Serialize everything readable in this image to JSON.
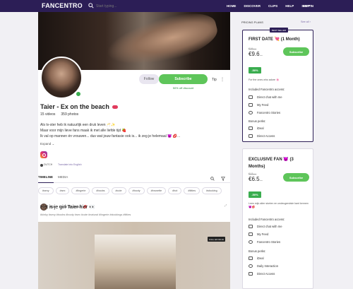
{
  "topnav": {
    "logo": "FANCENTRO",
    "search_placeholder": "Start typing...",
    "links": [
      "HOME",
      "DISCOVER",
      "CLIPS",
      "HELP",
      "SIGN IN"
    ],
    "language": "EN"
  },
  "profile": {
    "follow_label": "Follow",
    "subscribe_label": "Subscribe",
    "discount_label": "50% off discount",
    "tip_label": "Tip",
    "name": "Taier - Ex on the beach",
    "videos": "15 videos",
    "photos": "359 photos",
    "bio_lines": [
      "Als tv-ster heb ik natuurlijk een druk leven 🥂✨",
      "Maar voor mijn lieve fans maak ik met alle liefde tijd 🍓",
      "Ik val op mannen én vrouwen... dus wat jouw fantasie ook is... ik zeg je helemaal 😈 💋..."
    ],
    "expand_label": "Expand",
    "language_tag": "DUTCH",
    "translate_label": "Translate into English"
  },
  "tabs": [
    {
      "label": "TIMELINE",
      "active": true
    },
    {
      "label": "MEDIA",
      "active": false
    }
  ],
  "tagbar": [
    "#sexy",
    "#sex",
    "#lingerie",
    "#boobs",
    "#cute",
    "#booty",
    "#brunette",
    "#hot",
    "#titties",
    "#stocking"
  ],
  "post": {
    "author": "Taier - Ex on the beach 💋",
    "time": "·",
    "text": "Het is je girl Taier hier 👀",
    "tags": "#kinky  #sexy  #boobs  #booty  #sex  #cute  #natural  #lingerie  #stockings  #titties",
    "badge": "FULL HD 00:19"
  },
  "sidebar": {
    "title": "PRICING PLANS",
    "see_all": "See all",
    "plans": [
      {
        "badge": "BEST SELLER",
        "name": "FIRST DATE 💘 (1 Month)",
        "old_price": "€19.—",
        "price": "€9.6",
        "price_suffix": " —",
        "subscribe_label": "Subscribe",
        "discount_pct": "-50%",
        "description": "For the ones who adore 🌸",
        "included_title": "Included Fancentro access:",
        "included": [
          "Direct chat with me",
          "My Feed",
          "Fancentro Stories"
        ],
        "bonus_title": "Bonus perks:",
        "bonus": [
          "iDeal",
          "Direct Access"
        ]
      },
      {
        "name": "EXCLUSIVE FAN 😈 (3 Months)",
        "old_price": "€13.—",
        "price": "€6.5",
        "price_suffix": " —",
        "subscribe_label": "Subscribe",
        "discount_pct": "-50%",
        "description": "Lees mijn alter storten en ondeugendste kant kennen 😈💋",
        "included_title": "Included Fancentro access:",
        "included": [
          "Direct chat with me",
          "My Feed",
          "Fancentro Stories"
        ],
        "bonus_title": "Bonus perks:",
        "bonus": [
          "iDeal",
          "Daily Interaction",
          "Direct Access"
        ]
      }
    ]
  },
  "colors": {
    "nav": "#2c1e56",
    "accent_green": "#5ec55a",
    "discount_green": "#3aad4f",
    "link_purple": "#7b6aa8"
  }
}
